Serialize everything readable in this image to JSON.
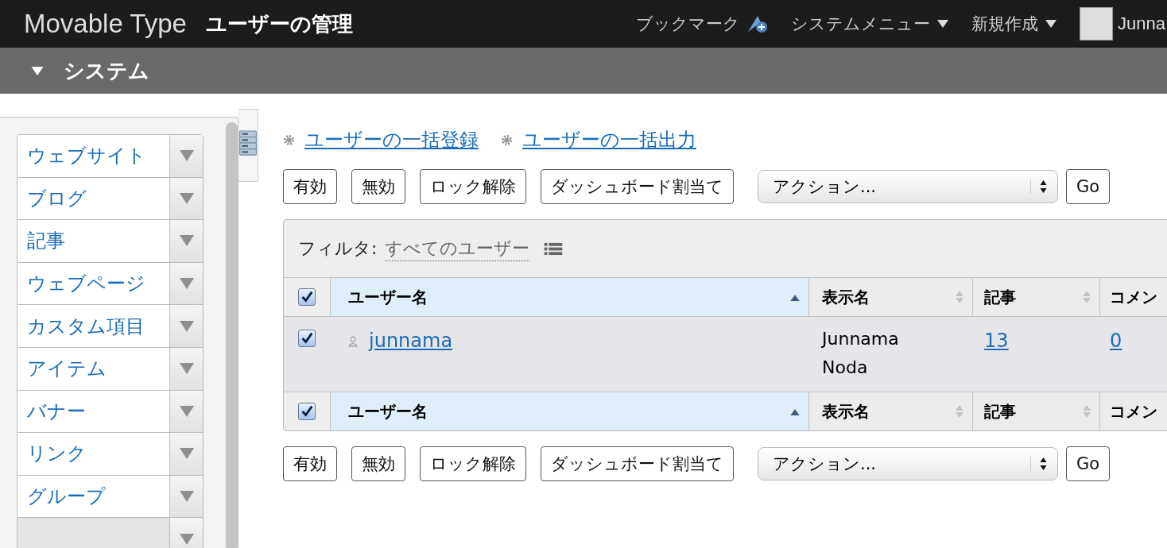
{
  "header": {
    "logo": "Movable Type",
    "page_title": "ユーザーの管理",
    "nav": [
      {
        "label": "ブックマーク",
        "kind": "bookmark"
      },
      {
        "label": "システムメニュー",
        "kind": "menu"
      },
      {
        "label": "新規作成",
        "kind": "menu"
      }
    ],
    "user": "Junna"
  },
  "scope_bar": {
    "label": "システム",
    "expanded": true
  },
  "sidebar": {
    "items": [
      {
        "label": "ウェブサイト",
        "selected": false
      },
      {
        "label": "ブログ",
        "selected": false
      },
      {
        "label": "記事",
        "selected": false
      },
      {
        "label": "ウェブページ",
        "selected": false
      },
      {
        "label": "カスタム項目",
        "selected": false
      },
      {
        "label": "アイテム",
        "selected": false
      },
      {
        "label": "バナー",
        "selected": false
      },
      {
        "label": "リンク",
        "selected": false
      },
      {
        "label": "グループ",
        "selected": false
      },
      {
        "selected": true
      }
    ]
  },
  "links": [
    "ユーザーの一括登録",
    "ユーザーの一括出力"
  ],
  "actions_top": {
    "buttons": [
      "有効",
      "無効",
      "ロック解除",
      "ダッシュボード割当て"
    ],
    "select": "アクション...",
    "go": "Go"
  },
  "filter": {
    "label": "フィルタ:",
    "value": "すべてのユーザー"
  },
  "table": {
    "header": {
      "checked": true,
      "columns": [
        {
          "label": "ユーザー名",
          "sorted": true
        },
        {
          "label": "表示名",
          "sorted": false
        },
        {
          "label": "記事",
          "sorted": false
        },
        {
          "label": "コメン",
          "sorted": false
        }
      ]
    },
    "rows": [
      {
        "checked": true,
        "username": "junnama",
        "display_name": "Junnama Noda",
        "entries": "13",
        "comments": "0"
      }
    ],
    "footer": {
      "checked": true,
      "columns": [
        {
          "label": "ユーザー名",
          "sorted": true
        },
        {
          "label": "表示名",
          "sorted": false
        },
        {
          "label": "記事",
          "sorted": false
        },
        {
          "label": "コメン",
          "sorted": false
        }
      ]
    }
  },
  "actions_bottom": {
    "buttons": [
      "有効",
      "無効",
      "ロック解除",
      "ダッシュボード割当て"
    ],
    "select": "アクション...",
    "go": "Go"
  }
}
